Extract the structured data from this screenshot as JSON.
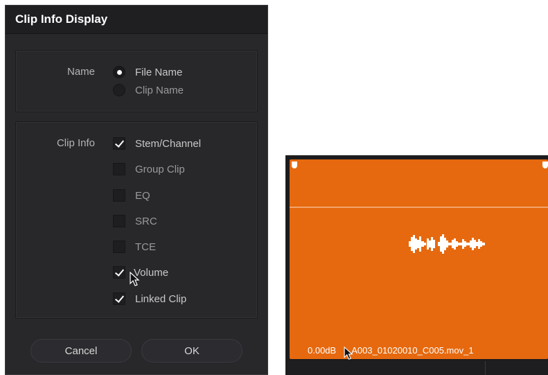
{
  "dialog": {
    "title": "Clip Info Display",
    "name_section": {
      "label": "Name",
      "options": [
        {
          "label": "File Name",
          "selected": true
        },
        {
          "label": "Clip Name",
          "selected": false
        }
      ]
    },
    "info_section": {
      "label": "Clip Info",
      "options": [
        {
          "label": "Stem/Channel",
          "checked": true
        },
        {
          "label": "Group Clip",
          "checked": false
        },
        {
          "label": "EQ",
          "checked": false
        },
        {
          "label": "SRC",
          "checked": false
        },
        {
          "label": "TCE",
          "checked": false
        },
        {
          "label": "Volume",
          "checked": true
        },
        {
          "label": "Linked Clip",
          "checked": true
        }
      ]
    },
    "buttons": {
      "cancel": "Cancel",
      "ok": "OK"
    }
  },
  "clip": {
    "volume": "0.00dB",
    "name": "A003_01020010_C005.mov_1",
    "color": "#e6690f"
  }
}
